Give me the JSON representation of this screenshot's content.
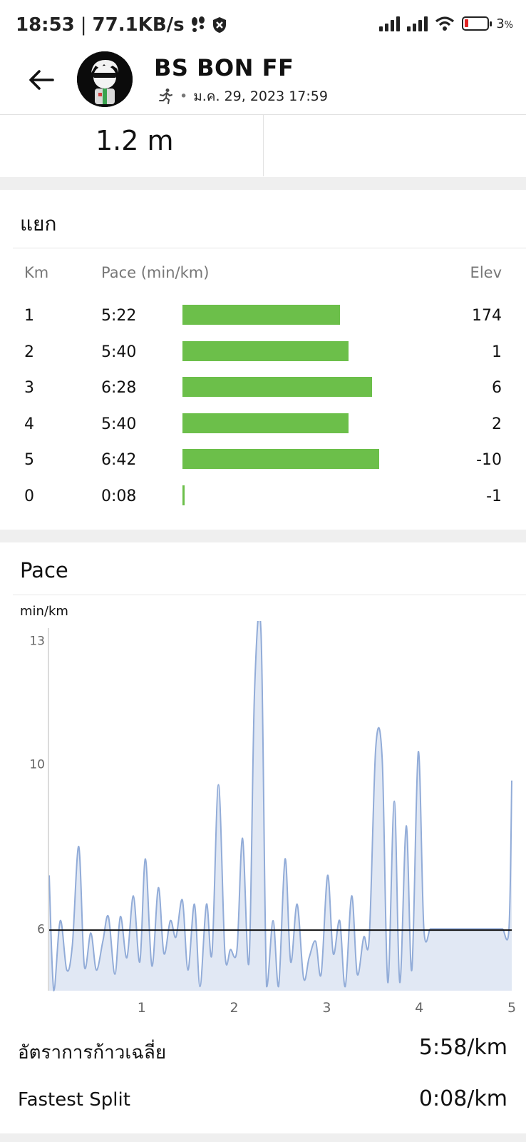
{
  "status_bar": {
    "time": "18:53",
    "separator": "|",
    "network_speed": "77.1KB/s",
    "battery_percent": "3",
    "battery_suffix": "%"
  },
  "header": {
    "athlete_name": "BS BON FF",
    "activity_date": "ม.ค. 29, 2023 17:59",
    "activity_type_icon": "running-person-icon"
  },
  "stat": {
    "value": "1.2 m"
  },
  "splits": {
    "title": "แยก",
    "columns": {
      "km": "Km",
      "pace": "Pace (min/km)",
      "elev": "Elev"
    },
    "rows": [
      {
        "km": "1",
        "pace": "5:22",
        "elev": "174",
        "bar_fraction": 0.8
      },
      {
        "km": "2",
        "pace": "5:40",
        "elev": "1",
        "bar_fraction": 0.845
      },
      {
        "km": "3",
        "pace": "6:28",
        "elev": "6",
        "bar_fraction": 0.965
      },
      {
        "km": "4",
        "pace": "5:40",
        "elev": "2",
        "bar_fraction": 0.845
      },
      {
        "km": "5",
        "pace": "6:42",
        "elev": "-10",
        "bar_fraction": 1.0
      },
      {
        "km": "0",
        "pace": "0:08",
        "elev": "-1",
        "bar_fraction": 0.012
      }
    ],
    "bar_color": "#6cbf4a"
  },
  "pace": {
    "title": "Pace",
    "unit_label": "min/km"
  },
  "chart_data": {
    "type": "area",
    "title": "Pace",
    "ylabel": "min/km",
    "xlabel": "",
    "x_ticks": [
      "1",
      "2",
      "3",
      "4",
      "5"
    ],
    "y_ticks": [
      "13",
      "10",
      "6"
    ],
    "xlim": [
      0,
      5.0
    ],
    "ylim": [
      4.5,
      13.3
    ],
    "average_line": 5.97,
    "line_color": "#92acd8",
    "fill_color": "#e1e8f4",
    "avg_line_color": "#111111",
    "series": [
      {
        "x": [
          0.0,
          0.05,
          0.12,
          0.19,
          0.25,
          0.32,
          0.38,
          0.45,
          0.51,
          0.58,
          0.64,
          0.71,
          0.77,
          0.84,
          0.91,
          0.98,
          1.04,
          1.11,
          1.18,
          1.24,
          1.31,
          1.37,
          1.44,
          1.5,
          1.57,
          1.63,
          1.7,
          1.76,
          1.83,
          1.9,
          1.96,
          2.03,
          2.09,
          2.16,
          2.22,
          2.29,
          2.35,
          2.42,
          2.48,
          2.55,
          2.61,
          2.68,
          2.75,
          2.81,
          2.88,
          2.94,
          3.01,
          3.07,
          3.14,
          3.2,
          3.27,
          3.33,
          3.4,
          3.46,
          3.53,
          3.6,
          3.66,
          3.73,
          3.79,
          3.86,
          3.92,
          3.99,
          4.05,
          4.12,
          4.18,
          4.25,
          4.32,
          4.38,
          4.45,
          4.51,
          4.58,
          4.64,
          4.71,
          4.77,
          4.84,
          4.9,
          4.97,
          5.0
        ],
        "y": [
          7.3,
          4.5,
          6.2,
          5.0,
          5.6,
          8.0,
          5.1,
          5.9,
          5.0,
          5.7,
          6.3,
          4.9,
          6.3,
          5.3,
          6.8,
          5.2,
          7.7,
          5.1,
          7.0,
          5.4,
          6.2,
          5.8,
          6.7,
          5.0,
          6.6,
          4.6,
          6.6,
          5.4,
          9.5,
          5.4,
          5.5,
          5.5,
          8.2,
          5.2,
          11.8,
          13.2,
          4.6,
          6.2,
          4.6,
          7.7,
          5.2,
          6.6,
          4.8,
          5.3,
          5.7,
          4.9,
          7.3,
          5.4,
          6.2,
          4.6,
          6.8,
          4.9,
          5.8,
          5.8,
          10.4,
          10.1,
          4.7,
          9.1,
          4.7,
          8.5,
          5.0,
          10.3,
          6.0,
          6.0,
          6.0,
          6.0,
          6.0,
          6.0,
          6.0,
          6.0,
          6.0,
          6.0,
          6.0,
          6.0,
          6.0,
          6.0,
          6.0,
          9.6
        ]
      }
    ]
  },
  "summary": [
    {
      "label": "อัตราการก้าวเฉลี่ย",
      "value": "5:58/km"
    },
    {
      "label": "Fastest Split",
      "value": "0:08/km"
    }
  ]
}
